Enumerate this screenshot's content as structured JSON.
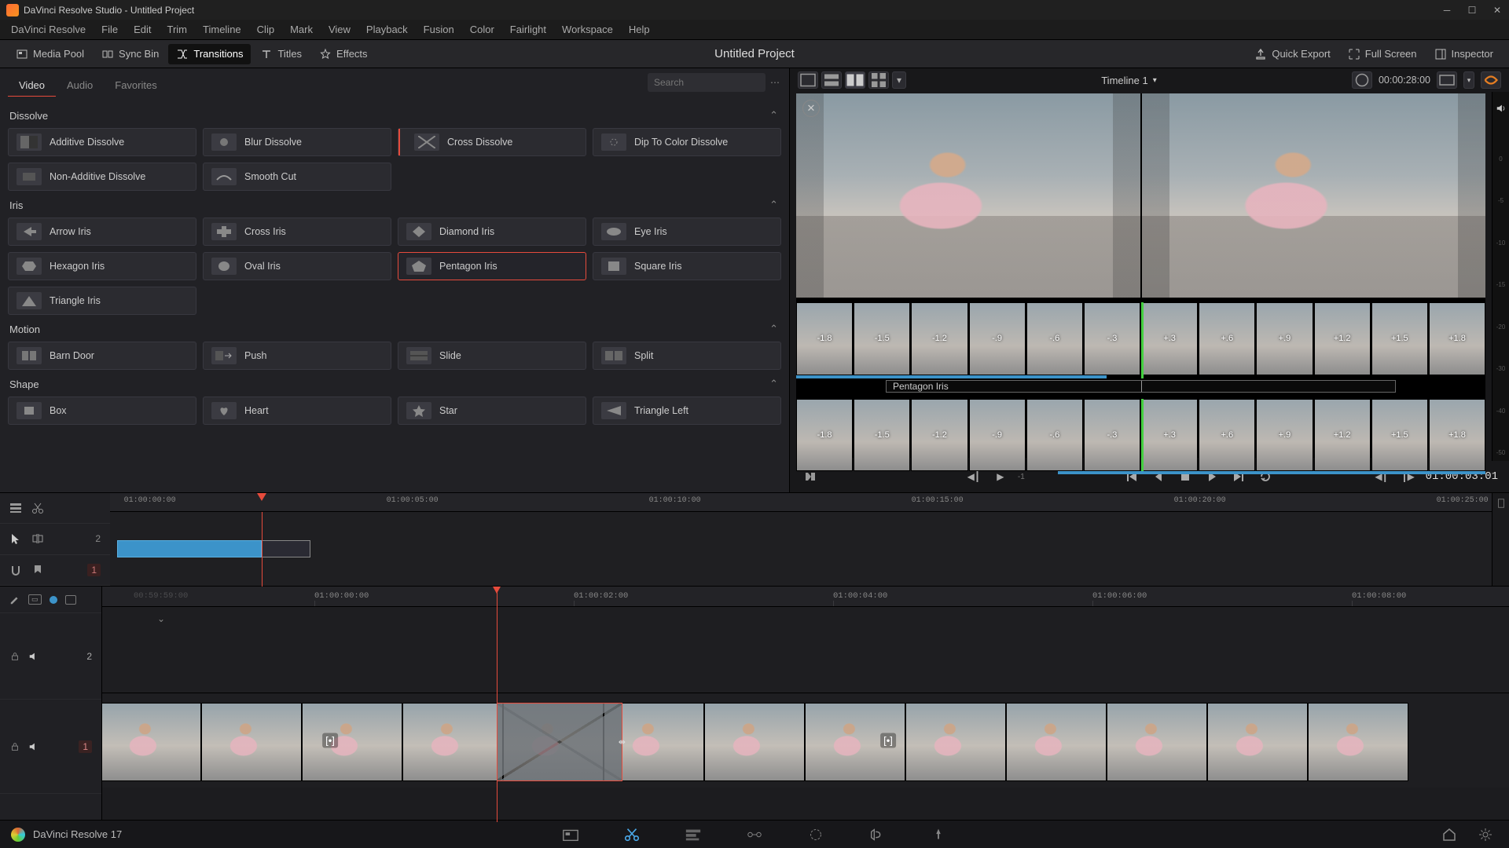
{
  "window": {
    "title": "DaVinci Resolve Studio - Untitled Project"
  },
  "menu": [
    "DaVinci Resolve",
    "File",
    "Edit",
    "Trim",
    "Timeline",
    "Clip",
    "Mark",
    "View",
    "Playback",
    "Fusion",
    "Color",
    "Fairlight",
    "Workspace",
    "Help"
  ],
  "topbar": {
    "left": [
      {
        "id": "media-pool",
        "label": "Media Pool"
      },
      {
        "id": "sync-bin",
        "label": "Sync Bin"
      },
      {
        "id": "transitions",
        "label": "Transitions",
        "active": true
      },
      {
        "id": "titles",
        "label": "Titles"
      },
      {
        "id": "effects",
        "label": "Effects"
      }
    ],
    "project_title": "Untitled Project",
    "right": [
      {
        "id": "quick-export",
        "label": "Quick Export"
      },
      {
        "id": "full-screen",
        "label": "Full Screen"
      },
      {
        "id": "inspector",
        "label": "Inspector"
      }
    ]
  },
  "transitions_panel": {
    "tabs": [
      {
        "id": "video",
        "label": "Video",
        "active": true
      },
      {
        "id": "audio",
        "label": "Audio"
      },
      {
        "id": "favorites",
        "label": "Favorites"
      }
    ],
    "search_placeholder": "Search",
    "categories": [
      {
        "name": "Dissolve",
        "items": [
          {
            "label": "Additive Dissolve",
            "icon": "fade"
          },
          {
            "label": "Blur Dissolve",
            "icon": "blur"
          },
          {
            "label": "Cross Dissolve",
            "icon": "cross",
            "recent": true
          },
          {
            "label": "Dip To Color Dissolve",
            "icon": "dip"
          },
          {
            "label": "Non-Additive Dissolve",
            "icon": "nad"
          },
          {
            "label": "Smooth Cut",
            "icon": "smooth"
          }
        ]
      },
      {
        "name": "Iris",
        "items": [
          {
            "label": "Arrow Iris",
            "icon": "arrow"
          },
          {
            "label": "Cross Iris",
            "icon": "plus"
          },
          {
            "label": "Diamond Iris",
            "icon": "diamond"
          },
          {
            "label": "Eye Iris",
            "icon": "eye"
          },
          {
            "label": "Hexagon Iris",
            "icon": "hex"
          },
          {
            "label": "Oval Iris",
            "icon": "oval"
          },
          {
            "label": "Pentagon Iris",
            "icon": "pentagon",
            "selected": true
          },
          {
            "label": "Square Iris",
            "icon": "square"
          },
          {
            "label": "Triangle Iris",
            "icon": "triangle"
          }
        ]
      },
      {
        "name": "Motion",
        "items": [
          {
            "label": "Barn Door",
            "icon": "barn"
          },
          {
            "label": "Push",
            "icon": "push"
          },
          {
            "label": "Slide",
            "icon": "slide"
          },
          {
            "label": "Split",
            "icon": "split"
          }
        ]
      },
      {
        "name": "Shape",
        "items": [
          {
            "label": "Box",
            "icon": "box"
          },
          {
            "label": "Heart",
            "icon": "heart"
          },
          {
            "label": "Star",
            "icon": "star"
          },
          {
            "label": "Triangle Left",
            "icon": "tri-left"
          }
        ]
      }
    ]
  },
  "viewer": {
    "timeline_name": "Timeline 1",
    "duration_tc": "00:00:28:00",
    "filmstrip_a": [
      "-1.8",
      "-1.5",
      "-1.2",
      "-.9",
      "-.6",
      "-.3"
    ],
    "filmstrip_b": [
      "+.3",
      "+.6",
      "+.9",
      "+1.2",
      "+1.5",
      "+1.8"
    ],
    "rev_a": [
      "-1.8",
      "-1.5",
      "-1.2",
      "-.9",
      "-.6",
      "-.3"
    ],
    "rev_b": [
      "+.3",
      "+.6",
      "+.9",
      "+1.2",
      "+1.5",
      "+1.8"
    ],
    "transition_label": "Pentagon Iris",
    "current_tc": "01:00:03:01"
  },
  "mini_timeline": {
    "ticks": [
      "01:00:00:00",
      "01:00:05:00",
      "01:00:10:00",
      "01:00:15:00",
      "01:00:20:00",
      "01:00:25:00"
    ],
    "track_nums": [
      "2",
      "1"
    ]
  },
  "big_timeline": {
    "ghost_tc": "00:59:59:00",
    "ticks": [
      "01:00:00:00",
      "01:00:02:00",
      "01:00:04:00",
      "01:00:06:00",
      "01:00:08:00"
    ],
    "track2_num": "2",
    "track1_num": "1"
  },
  "footer": {
    "app": "DaVinci Resolve 17"
  },
  "meter_marks": [
    "0",
    "-5",
    "-10",
    "-15",
    "-20",
    "-30",
    "-40",
    "-50"
  ]
}
